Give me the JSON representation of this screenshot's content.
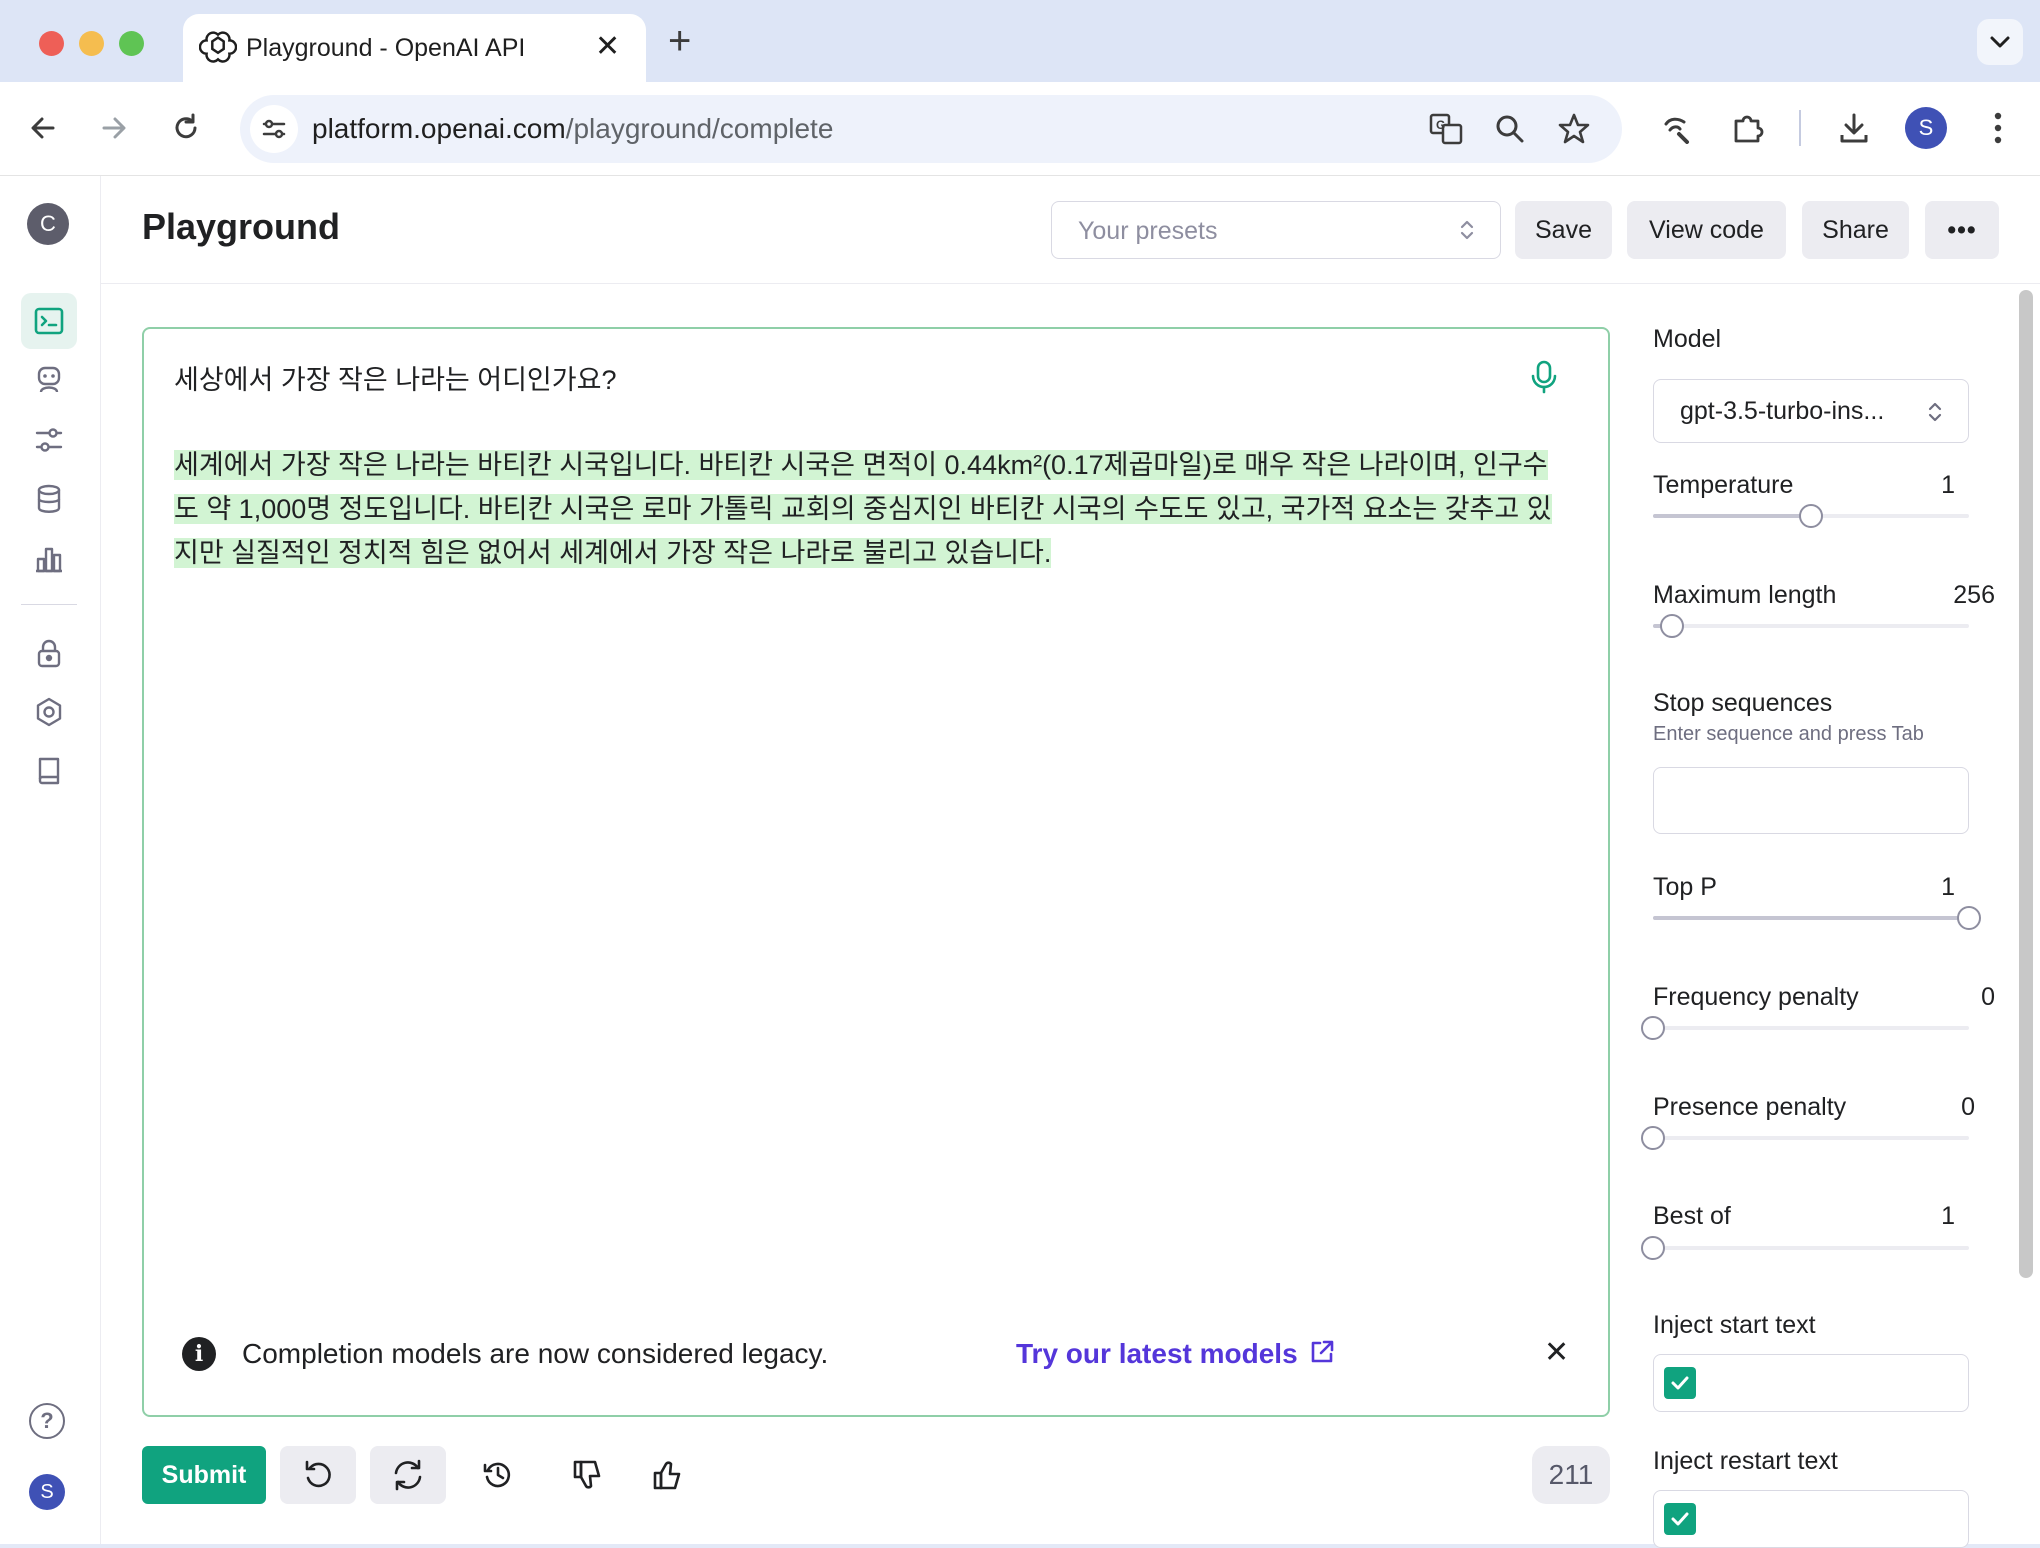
{
  "browser": {
    "tab_title": "Playground - OpenAI API",
    "tab_close": "✕",
    "new_tab": "+",
    "url_host": "platform.openai.com",
    "url_path": "/playground/complete",
    "profile_initial": "S"
  },
  "app": {
    "org_initial": "C",
    "user_initial": "S",
    "nav_items": [
      "playground-icon",
      "assistants-icon",
      "fine-tuning-icon",
      "storage-icon",
      "usage-icon",
      "api-keys-icon",
      "settings-icon",
      "docs-icon"
    ],
    "help_icon": "?"
  },
  "header": {
    "title": "Playground",
    "presets_placeholder": "Your presets",
    "save_label": "Save",
    "view_code_label": "View code",
    "share_label": "Share",
    "more_label": "•••"
  },
  "editor": {
    "prompt": "세상에서 가장 작은 나라는 어디인가요?",
    "completion_lines": [
      "세계에서 가장 작은 나라는 바티칸 시국입니다. 바티칸 시국은 면적이 0.44km²(0.17제곱마일)로 매우 작은 나라이며, 인구수",
      "도 약 1,000명 정도입니다. 바티칸 시국은 로마 가톨릭 교회의 중심지인 바티칸 시국의 수도도 있고, 국가적 요소는 갖추고 있",
      "지만 실질적인 정치적 힘은 없어서 세계에서 가장 작은 나라로 불리고 있습니다."
    ],
    "legacy_notice": "Completion models are now considered legacy.",
    "legacy_link": "Try our latest models",
    "legacy_close": "✕",
    "info_glyph": "i"
  },
  "bottombar": {
    "submit_label": "Submit",
    "token_count": "211"
  },
  "settings": {
    "model_label": "Model",
    "model_value": "gpt-3.5-turbo-ins...",
    "temperature_label": "Temperature",
    "temperature_value": "1",
    "temperature_fraction": 0.5,
    "max_length_label": "Maximum length",
    "max_length_value": "256",
    "max_length_fraction": 0.06,
    "stop_label": "Stop sequences",
    "stop_hint": "Enter sequence and press Tab",
    "top_p_label": "Top P",
    "top_p_value": "1",
    "top_p_fraction": 1.0,
    "frequency_label": "Frequency penalty",
    "frequency_value": "0",
    "frequency_fraction": 0.0,
    "presence_label": "Presence penalty",
    "presence_value": "0",
    "presence_fraction": 0.0,
    "best_of_label": "Best of",
    "best_of_value": "1",
    "best_of_fraction": 0.0,
    "inject_start_label": "Inject start text",
    "inject_start_checked": true,
    "inject_restart_label": "Inject restart text",
    "inject_restart_checked": true
  },
  "colors": {
    "accent": "#10a37f",
    "highlight": "#d2f4d3",
    "link": "#5436da"
  }
}
